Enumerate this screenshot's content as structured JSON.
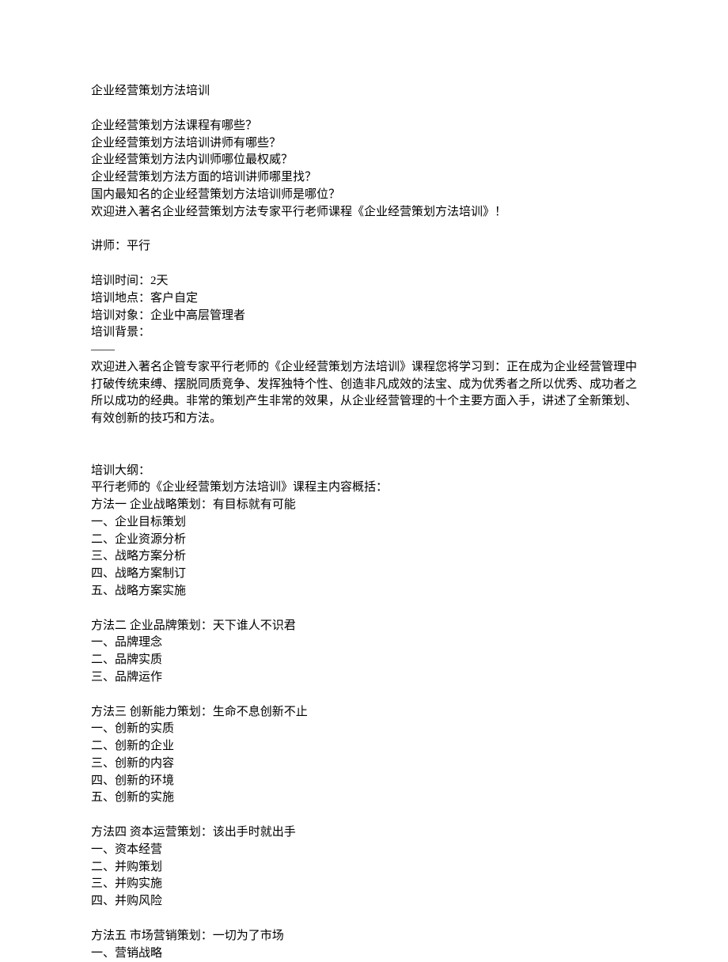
{
  "title": "企业经营策划方法培训",
  "intro_questions": [
    "企业经营策划方法课程有哪些？",
    "企业经营策划方法培训讲师有哪些？",
    "企业经营策划方法内训师哪位最权威？",
    "企业经营策划方法方面的培训讲师哪里找？",
    "国内最知名的企业经营策划方法培训师是哪位？",
    "欢迎进入著名企业经营策划方法专家平行老师课程《企业经营策划方法培训》！"
  ],
  "instructor_line": "讲师：平行",
  "training_info": {
    "duration": "培训时间：2天",
    "location": "培训地点：客户自定",
    "target": "培训对象：企业中高层管理者",
    "background_label": "培训背景：",
    "divider": "——",
    "background_text": "欢迎进入著名企管专家平行老师的《企业经营策划方法培训》课程您将学习到：正在成为企业经营管理中打破传统束缚、摆脱同质竞争、发挥独特个性、创造非凡成效的法宝、成为优秀者之所以优秀、成功者之所以成功的经典。非常的策划产生非常的效果，从企业经营管理的十个主要方面入手，讲述了全新策划、有效创新的技巧和方法。"
  },
  "outline": {
    "header": "培训大纲：",
    "subheader": "平行老师的《企业经营策划方法培训》课程主内容概括：",
    "method1": {
      "title": "方法一 企业战略策划：有目标就有可能",
      "items": [
        "一、企业目标策划",
        "二、企业资源分析",
        "三、战略方案分析",
        "四、战略方案制订",
        "五、战略方案实施"
      ]
    },
    "method2": {
      "title": "方法二 企业品牌策划：天下谁人不识君",
      "items": [
        "一、品牌理念",
        "二、品牌实质",
        "三、品牌运作"
      ]
    },
    "method3": {
      "title": "方法三 创新能力策划：生命不息创新不止",
      "items": [
        "一、创新的实质",
        "二、创新的企业",
        "三、创新的内容",
        "四、创新的环境",
        "五、创新的实施"
      ]
    },
    "method4": {
      "title": "方法四 资本运营策划：该出手时就出手",
      "items": [
        "一、资本经营",
        "二、并购策划",
        "三、并购实施",
        "四、并购风险"
      ]
    },
    "method5": {
      "title": "方法五 市场营销策划：一切为了市场",
      "items": [
        "一、营销战略"
      ]
    }
  }
}
